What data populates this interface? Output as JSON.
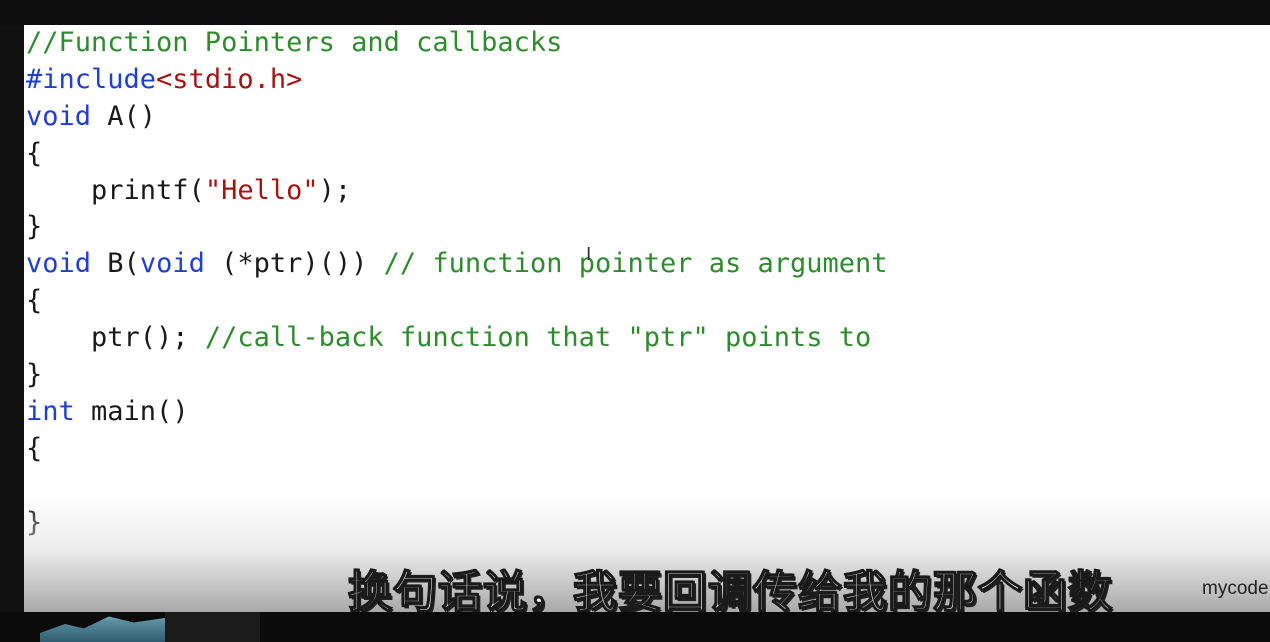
{
  "code": {
    "line_1": "//Function Pointers and callbacks",
    "line_2_directive": "#include",
    "line_2_header": "<stdio.h>",
    "line_3_kw": "void",
    "line_3_rest": " A()",
    "line_4": "{",
    "line_5_call": "    printf(",
    "line_5_str": "\"Hello\"",
    "line_5_end": ");",
    "line_6": "}",
    "line_7_kw": "void",
    "line_7_b": " B(",
    "line_7_kw2": "void",
    "line_7_rest": " (*ptr)()) ",
    "line_7_comment": "// function pointer as argument",
    "line_8": "{",
    "line_9_code": "    ptr(); ",
    "line_9_comment": "//call-back function that \"ptr\" points to",
    "line_10": "}",
    "line_11_kw": "int",
    "line_11_rest": " main()",
    "line_12": "{",
    "line_13": "",
    "line_14": "}"
  },
  "subtitle": "换句话说，我要回调传给我的那个函数",
  "watermark": "mycode",
  "colors": {
    "comment": "#2e8b2e",
    "keyword": "#1f3fd0",
    "string": "#a31515",
    "text": "#1a1a1a"
  }
}
